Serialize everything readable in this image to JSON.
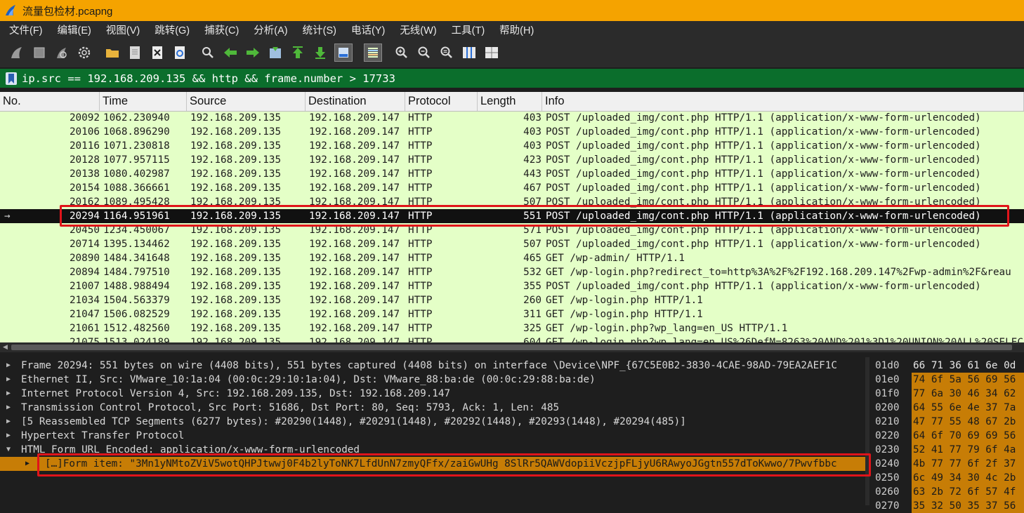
{
  "window": {
    "title": "流量包检材.pcapng"
  },
  "menu": [
    "文件(F)",
    "编辑(E)",
    "视图(V)",
    "跳转(G)",
    "捕获(C)",
    "分析(A)",
    "统计(S)",
    "电话(Y)",
    "无线(W)",
    "工具(T)",
    "帮助(H)"
  ],
  "toolbar": {
    "icons": [
      "shark-fin-start-icon",
      "stop-square-icon",
      "restart-fin-icon",
      "gear-options-icon",
      "folder-open-icon",
      "file-save-icon",
      "close-file-icon",
      "reload-icon",
      "find-magnifier-icon",
      "go-back-arrow-icon",
      "go-forward-arrow-icon",
      "go-to-packet-icon",
      "go-first-icon",
      "go-last-icon",
      "autoscroll-icon",
      "colorize-icon",
      "zoom-in-icon",
      "zoom-out-icon",
      "zoom-normal-icon",
      "resize-columns-icon",
      "layout-icon"
    ]
  },
  "filter": {
    "value": "ip.src == 192.168.209.135 && http && frame.number > 17733"
  },
  "packet_list": {
    "columns": [
      "No.",
      "Time",
      "Source",
      "Destination",
      "Protocol",
      "Length",
      "Info"
    ],
    "rows": [
      [
        "20092",
        "1062.230940",
        "192.168.209.135",
        "192.168.209.147",
        "HTTP",
        "403",
        "POST /uploaded_img/cont.php HTTP/1.1  (application/x-www-form-urlencoded)"
      ],
      [
        "20106",
        "1068.896290",
        "192.168.209.135",
        "192.168.209.147",
        "HTTP",
        "403",
        "POST /uploaded_img/cont.php HTTP/1.1  (application/x-www-form-urlencoded)"
      ],
      [
        "20116",
        "1071.230818",
        "192.168.209.135",
        "192.168.209.147",
        "HTTP",
        "403",
        "POST /uploaded_img/cont.php HTTP/1.1  (application/x-www-form-urlencoded)"
      ],
      [
        "20128",
        "1077.957115",
        "192.168.209.135",
        "192.168.209.147",
        "HTTP",
        "423",
        "POST /uploaded_img/cont.php HTTP/1.1  (application/x-www-form-urlencoded)"
      ],
      [
        "20138",
        "1080.402987",
        "192.168.209.135",
        "192.168.209.147",
        "HTTP",
        "443",
        "POST /uploaded_img/cont.php HTTP/1.1  (application/x-www-form-urlencoded)"
      ],
      [
        "20154",
        "1088.366661",
        "192.168.209.135",
        "192.168.209.147",
        "HTTP",
        "467",
        "POST /uploaded_img/cont.php HTTP/1.1  (application/x-www-form-urlencoded)"
      ],
      [
        "20162",
        "1089.495428",
        "192.168.209.135",
        "192.168.209.147",
        "HTTP",
        "507",
        "POST /uploaded_img/cont.php HTTP/1.1  (application/x-www-form-urlencoded)"
      ],
      [
        "20294",
        "1164.951961",
        "192.168.209.135",
        "192.168.209.147",
        "HTTP",
        "551",
        "POST /uploaded_img/cont.php HTTP/1.1  (application/x-www-form-urlencoded)"
      ],
      [
        "20450",
        "1234.450067",
        "192.168.209.135",
        "192.168.209.147",
        "HTTP",
        "571",
        "POST /uploaded_img/cont.php HTTP/1.1  (application/x-www-form-urlencoded)"
      ],
      [
        "20714",
        "1395.134462",
        "192.168.209.135",
        "192.168.209.147",
        "HTTP",
        "507",
        "POST /uploaded_img/cont.php HTTP/1.1  (application/x-www-form-urlencoded)"
      ],
      [
        "20890",
        "1484.341648",
        "192.168.209.135",
        "192.168.209.147",
        "HTTP",
        "465",
        "GET /wp-admin/ HTTP/1.1"
      ],
      [
        "20894",
        "1484.797510",
        "192.168.209.135",
        "192.168.209.147",
        "HTTP",
        "532",
        "GET /wp-login.php?redirect_to=http%3A%2F%2F192.168.209.147%2Fwp-admin%2F&reau"
      ],
      [
        "21007",
        "1488.988494",
        "192.168.209.135",
        "192.168.209.147",
        "HTTP",
        "355",
        "POST /uploaded_img/cont.php HTTP/1.1  (application/x-www-form-urlencoded)"
      ],
      [
        "21034",
        "1504.563379",
        "192.168.209.135",
        "192.168.209.147",
        "HTTP",
        "260",
        "GET /wp-login.php HTTP/1.1"
      ],
      [
        "21047",
        "1506.082529",
        "192.168.209.135",
        "192.168.209.147",
        "HTTP",
        "311",
        "GET /wp-login.php HTTP/1.1"
      ],
      [
        "21061",
        "1512.482560",
        "192.168.209.135",
        "192.168.209.147",
        "HTTP",
        "325",
        "GET /wp-login.php?wp_lang=en_US HTTP/1.1"
      ],
      [
        "21075",
        "1513.024189",
        "192.168.209.135",
        "192.168.209.147",
        "HTTP",
        "604",
        "GET /wp-login.php?wp_lang=en_US%26DefM=8263%20AND%201%3D1%20UNION%20ALL%20SELEC"
      ]
    ],
    "selected_index": 7
  },
  "details": [
    {
      "text": "Frame 20294: 551 bytes on wire (4408 bits), 551 bytes captured (4408 bits) on interface \\Device\\NPF_{67C5E0B2-3830-4CAE-98AD-79EA2AEF1C",
      "expanded": false
    },
    {
      "text": "Ethernet II, Src: VMware_10:1a:04 (00:0c:29:10:1a:04), Dst: VMware_88:ba:de (00:0c:29:88:ba:de)",
      "expanded": false
    },
    {
      "text": "Internet Protocol Version 4, Src: 192.168.209.135, Dst: 192.168.209.147",
      "expanded": false
    },
    {
      "text": "Transmission Control Protocol, Src Port: 51686, Dst Port: 80, Seq: 5793, Ack: 1, Len: 485",
      "expanded": false
    },
    {
      "text": "[5 Reassembled TCP Segments (6277 bytes): #20290(1448), #20291(1448), #20292(1448), #20293(1448), #20294(485)]",
      "expanded": false
    },
    {
      "text": "Hypertext Transfer Protocol",
      "expanded": false
    },
    {
      "text": "HTML Form URL Encoded: application/x-www-form-urlencoded",
      "expanded": true
    },
    {
      "text": "[…]Form item: \"3Mn1yNMtoZViV5wotQHPJtwwj0F4b2lyToNK7LfdUnN7zmyQFfx/zaiGwUHg 8SlRr5QAWVdopiiVczjpFLjyU6RAwyoJGgtn557dToKwwo/7Pwvfbbc",
      "expanded": false,
      "child": true
    }
  ],
  "bytes": [
    {
      "offset": "01d0",
      "hex": "66 71 36 61 6e 0d"
    },
    {
      "offset": "01e0",
      "hex": "74 6f 5a 56 69 56"
    },
    {
      "offset": "01f0",
      "hex": "77 6a 30 46 34 62"
    },
    {
      "offset": "0200",
      "hex": "64 55 6e 4e 37 7a"
    },
    {
      "offset": "0210",
      "hex": "47 77 55 48 67 2b"
    },
    {
      "offset": "0220",
      "hex": "64 6f 70 69 69 56"
    },
    {
      "offset": "0230",
      "hex": "52 41 77 79 6f 4a"
    },
    {
      "offset": "0240",
      "hex": "4b 77 77 6f 2f 37"
    },
    {
      "offset": "0250",
      "hex": "6c 49 34 30 4c 2b"
    },
    {
      "offset": "0260",
      "hex": "63 2b 72 6f 57 4f"
    },
    {
      "offset": "0270",
      "hex": "35 32 50 35 37 56"
    }
  ],
  "colors": {
    "titlebar": "#f5a300",
    "menubar": "#2b2b2b",
    "filter_ok": "#0b6e2c",
    "row_http": "#e4ffc7",
    "row_selected": "#111111",
    "detail_highlight": "#c77d06",
    "annotation_red": "#e0141a"
  }
}
